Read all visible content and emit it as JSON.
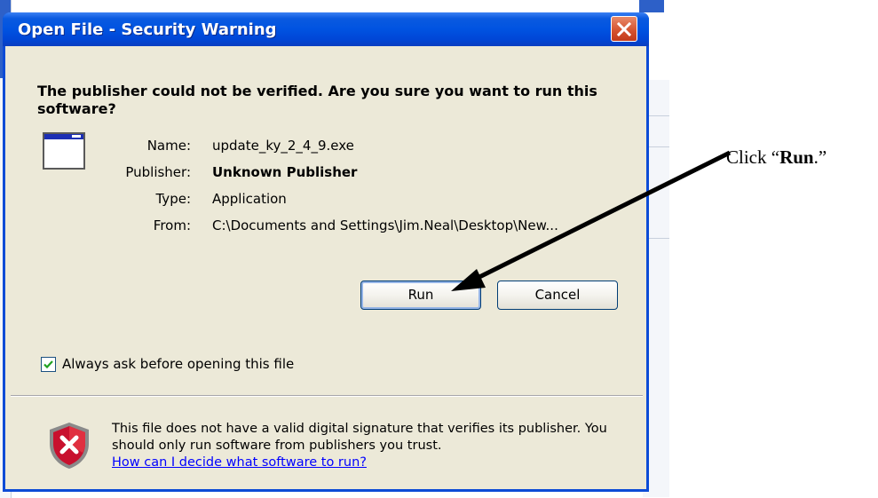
{
  "dialog": {
    "title": "Open File - Security Warning",
    "headline": "The publisher could not be verified.  Are you sure you want to run this software?",
    "fields": [
      {
        "label": "Name:",
        "value": "update_ky_2_4_9.exe",
        "bold": false
      },
      {
        "label": "Publisher:",
        "value": "Unknown Publisher",
        "bold": true
      },
      {
        "label": "Type:",
        "value": "Application",
        "bold": false
      },
      {
        "label": "From:",
        "value": "C:\\Documents and Settings\\Jim.Neal\\Desktop\\New...",
        "bold": false
      }
    ],
    "run_label": "Run",
    "cancel_label": "Cancel",
    "checkbox_label": "Always ask before opening this file",
    "checkbox_checked": true,
    "warning_text": "This file does not have a valid digital signature that verifies its publisher.  You should only run software from publishers you trust.",
    "warning_link": "How can I decide what software to run?"
  },
  "annotation": {
    "prefix": "Click “",
    "emphasis": "Run",
    "suffix": ".”"
  },
  "colors": {
    "titlebar": "#0053e1",
    "dialog_bg": "#ece9d8",
    "close_button": "#d4502c",
    "link": "#0000ff",
    "shield": "#c8102e"
  },
  "icons": {
    "app": "application-window-icon",
    "close": "close-icon",
    "check": "checkmark-icon",
    "shield": "security-shield-icon",
    "arrow": "pointer-arrow"
  }
}
